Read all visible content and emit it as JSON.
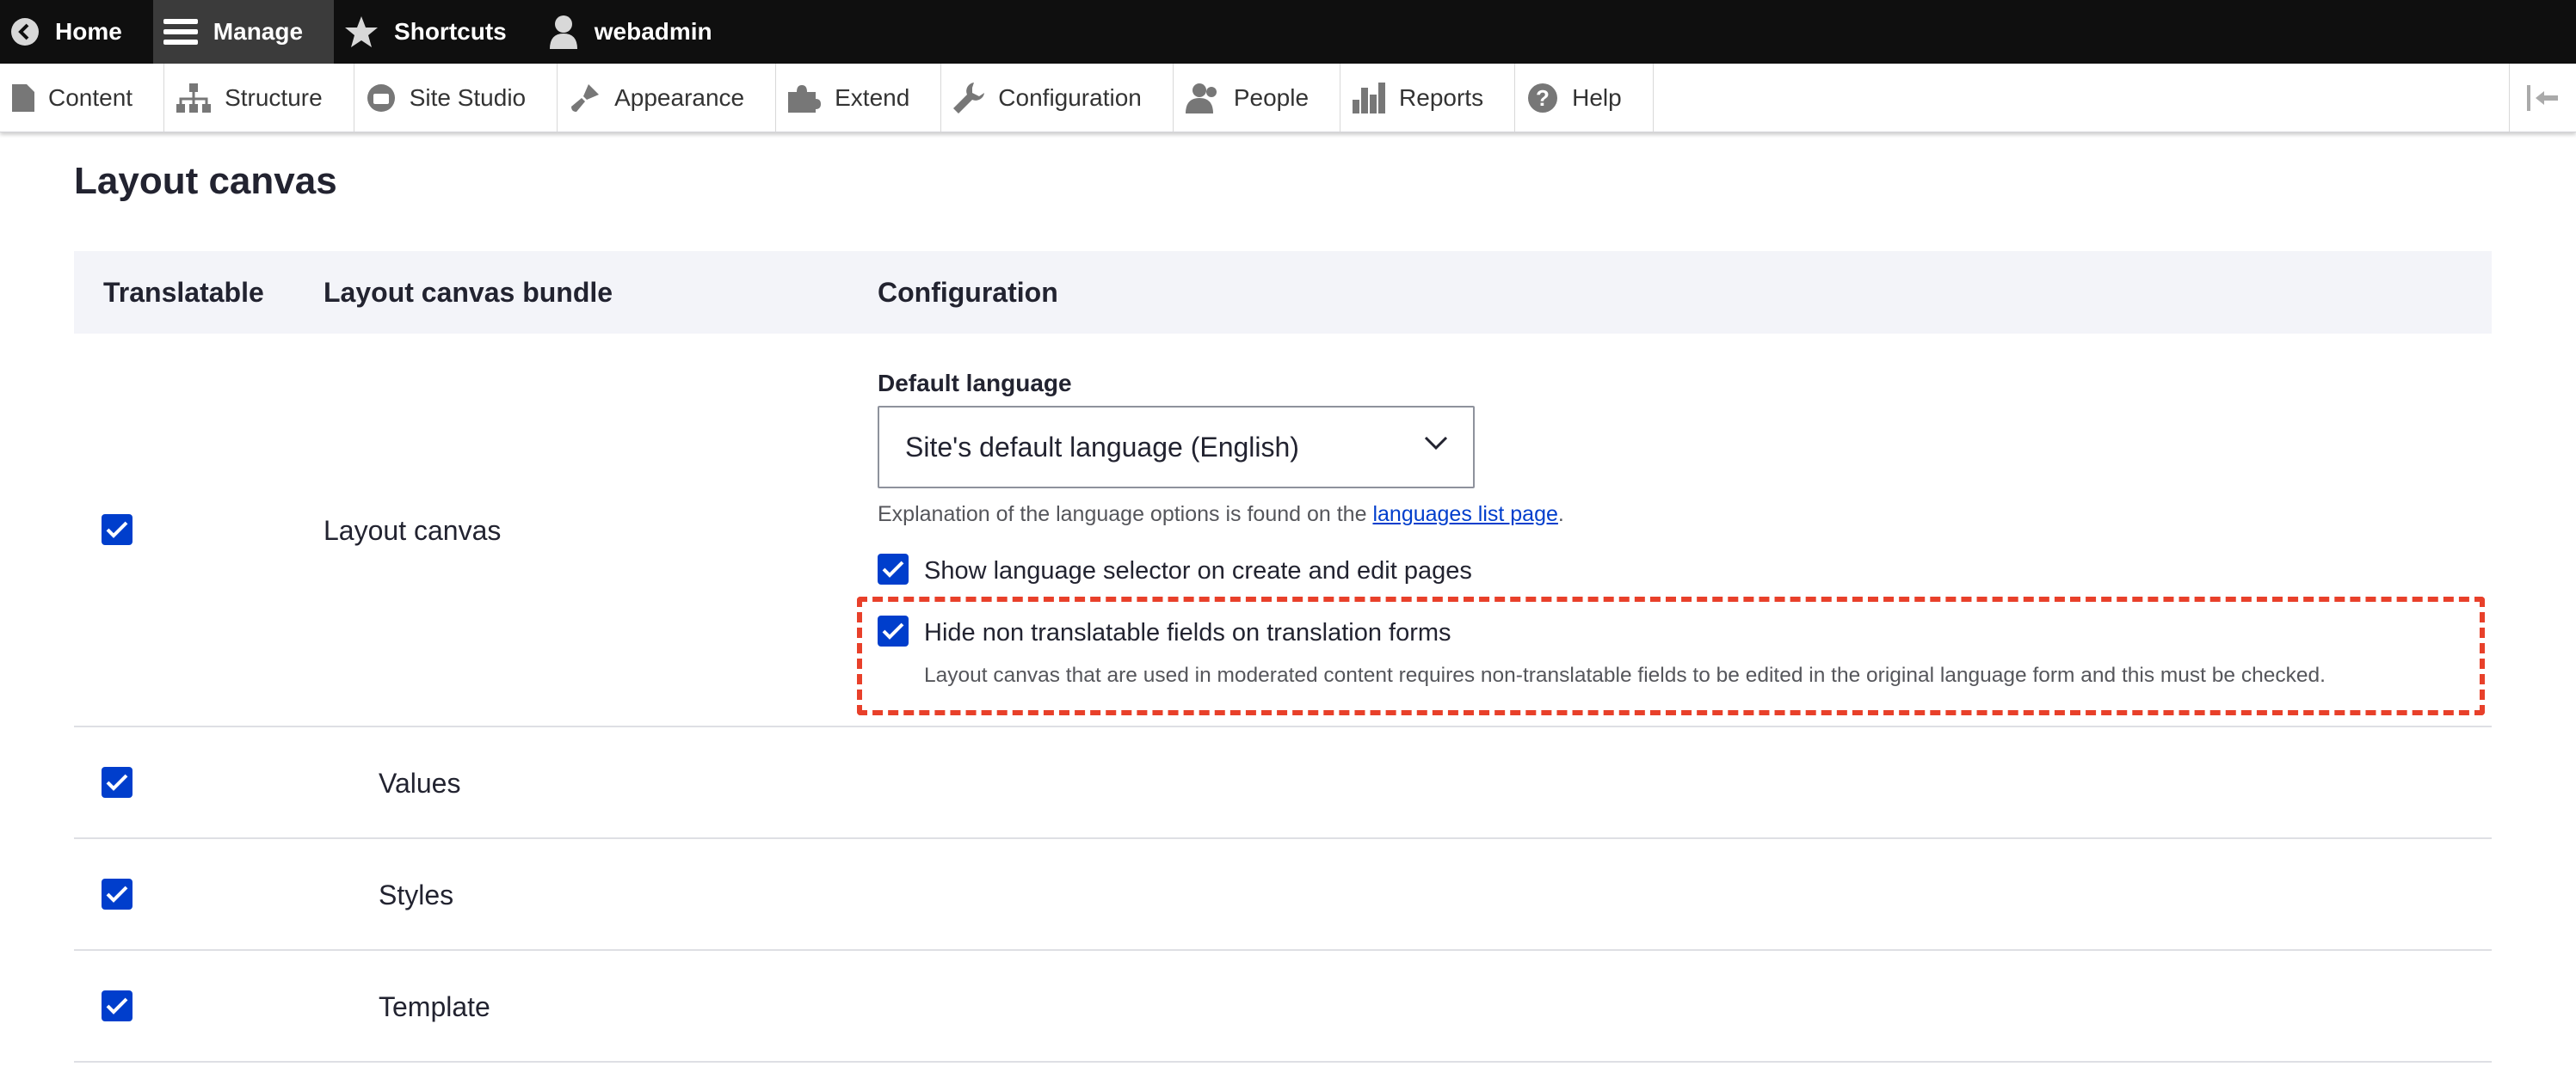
{
  "toolbar": {
    "home": "Home",
    "manage": "Manage",
    "shortcuts": "Shortcuts",
    "user": "webadmin"
  },
  "tray": {
    "items": [
      "Content",
      "Structure",
      "Site Studio",
      "Appearance",
      "Extend",
      "Configuration",
      "People",
      "Reports",
      "Help"
    ]
  },
  "page": {
    "title": "Layout canvas"
  },
  "table": {
    "headers": {
      "translatable": "Translatable",
      "bundle": "Layout canvas bundle",
      "configuration": "Configuration"
    },
    "main_row": {
      "bundle": "Layout canvas",
      "translatable_checked": true,
      "default_language_label": "Default language",
      "default_language_value": "Site's default language (English)",
      "explanation_prefix": "Explanation of the language options is found on the ",
      "explanation_link": "languages list page",
      "explanation_suffix": ".",
      "show_selector_label": "Show language selector on create and edit pages",
      "hide_non_translatable_label": "Hide non translatable fields on translation forms",
      "hide_non_translatable_desc": "Layout canvas that are used in moderated content requires non-translatable fields to be edited in the original language form and this must be checked."
    },
    "sub_rows": [
      {
        "label": "Values",
        "checked": true
      },
      {
        "label": "Styles",
        "checked": true
      },
      {
        "label": "Template",
        "checked": true
      }
    ]
  },
  "colors": {
    "accent": "#003ecc",
    "highlight": "#e8402a",
    "toolbar_bg": "#0f0f0f"
  }
}
